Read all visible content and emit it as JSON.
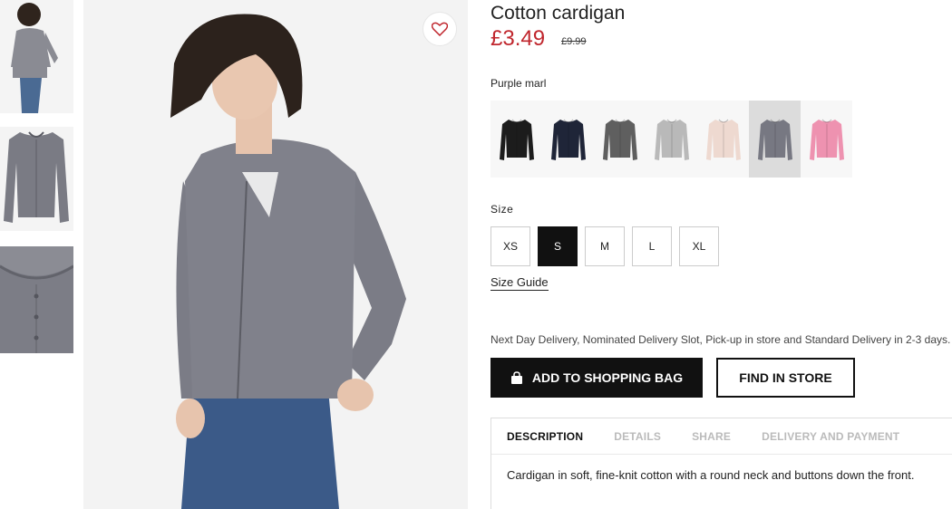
{
  "product": {
    "title": "Cotton cardigan",
    "price": "£3.49",
    "old_price": "£9.99",
    "color_name": "Purple marl",
    "wishlist_icon": "heart-icon",
    "colors": [
      {
        "name": "black",
        "hex": "#1c1c1c"
      },
      {
        "name": "navy",
        "hex": "#1f2538"
      },
      {
        "name": "dark-grey",
        "hex": "#5f5f5f"
      },
      {
        "name": "light-grey",
        "hex": "#b9b9b9"
      },
      {
        "name": "light-pink",
        "hex": "#eed9d0"
      },
      {
        "name": "purple-marl",
        "hex": "#777882",
        "selected": true
      },
      {
        "name": "pink",
        "hex": "#ee92b0"
      }
    ]
  },
  "size": {
    "label": "Size",
    "options": [
      "XS",
      "S",
      "M",
      "L",
      "XL"
    ],
    "selected": "S",
    "guide_label": "Size Guide"
  },
  "delivery_text": "Next Day Delivery, Nominated Delivery Slot, Pick-up in store and Standard Delivery in 2-3 days.",
  "actions": {
    "add_to_bag": "ADD TO SHOPPING BAG",
    "add_to_bag_icon": "shopping-bag-icon",
    "find_in_store": "FIND IN STORE"
  },
  "tabs": [
    "DESCRIPTION",
    "DETAILS",
    "SHARE",
    "DELIVERY AND PAYMENT"
  ],
  "active_tab": "DESCRIPTION",
  "description": "Cardigan in soft, fine-knit cotton with a round neck and buttons down the front.",
  "colors": {
    "price_red": "#c0262d",
    "cardigan_grey": "#777882"
  }
}
